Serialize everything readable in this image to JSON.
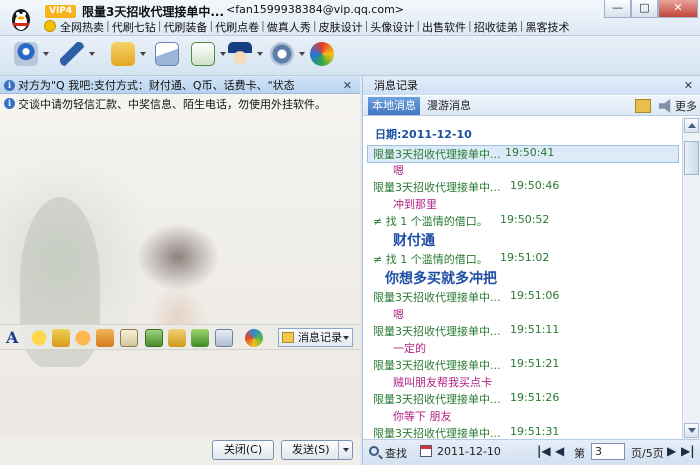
{
  "window": {
    "contact_name": "限量3天招收代理接单中...",
    "contact_email": "<fan1599938384@vip.qq.com>",
    "vip_label": "VIP4",
    "links": [
      "全网热卖",
      "代刷七钻",
      "代刷装备",
      "代刷点卷",
      "做真人秀",
      "皮肤设计",
      "头像设计",
      "出售软件",
      "招收徒弟",
      "黑客技术"
    ],
    "minimize_label": "—",
    "maximize_label": "□",
    "close_label": "✕"
  },
  "chat": {
    "notice": "对方为\"Q 我吧:支付方式：财付通、Q币、话费卡、\"状态",
    "warning": "交谈中请勿轻信汇款、中奖信息、陌生电话，勿使用外挂软件。",
    "history_button": "消息记录",
    "close_button": "关闭(C)",
    "send_button": "发送(S)"
  },
  "history": {
    "title": "消息记录",
    "tab_local": "本地消息",
    "tab_roaming": "漫游消息",
    "more_label": "更多",
    "date_label": "日期:2011-12-10",
    "entries": [
      {
        "kind": "header",
        "who": "限量3天招收代理接单中...",
        "time": "19:50:41",
        "selected": true
      },
      {
        "kind": "msg",
        "text": "嗯",
        "style": "magenta"
      },
      {
        "kind": "header",
        "who": "限量3天招收代理接单中...",
        "time": "19:50:46"
      },
      {
        "kind": "msg",
        "text": "冲到那里",
        "style": "magenta"
      },
      {
        "kind": "sys",
        "who": "≠  找 1 个滥情的借口。",
        "time": "19:50:52"
      },
      {
        "kind": "msg",
        "text": "财付通",
        "style": "big"
      },
      {
        "kind": "sys",
        "who": "≠  找 1 个滥情的借口。",
        "time": "19:51:02"
      },
      {
        "kind": "msg",
        "text": "你想多买就多冲把",
        "style": "big2"
      },
      {
        "kind": "header",
        "who": "限量3天招收代理接单中...",
        "time": "19:51:06"
      },
      {
        "kind": "msg",
        "text": "嗯",
        "style": "magenta"
      },
      {
        "kind": "header",
        "who": "限量3天招收代理接单中...",
        "time": "19:51:11"
      },
      {
        "kind": "msg",
        "text": "一定的",
        "style": "magenta"
      },
      {
        "kind": "header",
        "who": "限量3天招收代理接单中...",
        "time": "19:51:21"
      },
      {
        "kind": "msg",
        "text": "贼叫朋友帮我买点卡",
        "style": "magenta"
      },
      {
        "kind": "header",
        "who": "限量3天招收代理接单中...",
        "time": "19:51:26"
      },
      {
        "kind": "msg",
        "text": "你等下  朋友",
        "style": "magenta"
      },
      {
        "kind": "header",
        "who": "限量3天招收代理接单中...",
        "time": "19:51:31"
      }
    ],
    "search_label": "查找",
    "date_filter": "2011-12-10",
    "page_prefix": "第",
    "page_value": "3",
    "page_suffix": "页/5页"
  }
}
